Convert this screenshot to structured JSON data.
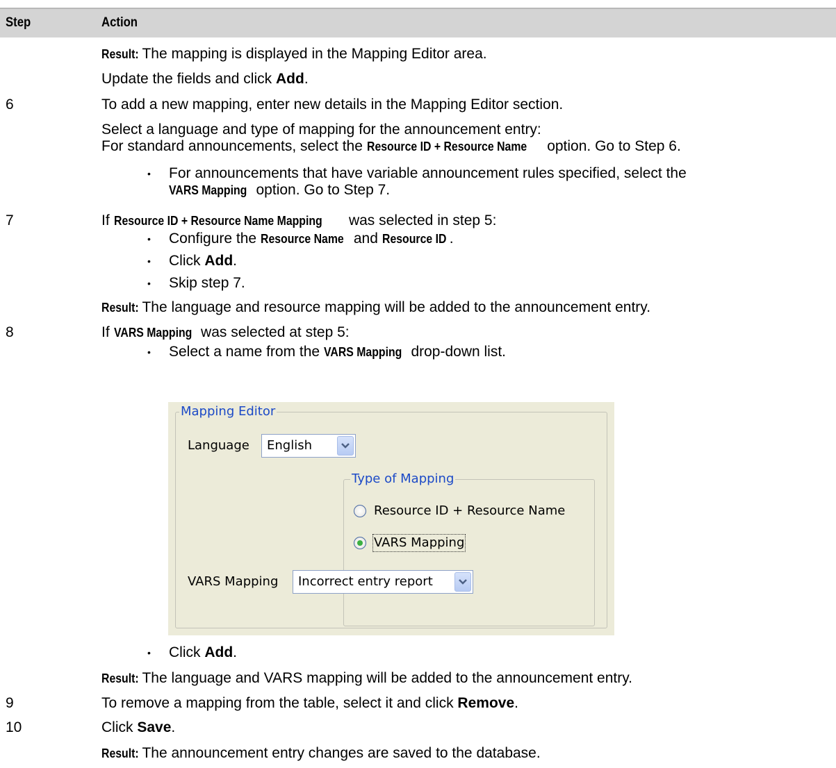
{
  "header": {
    "step": "Step",
    "action": "Action"
  },
  "rows": {
    "result1": {
      "label": "Result:",
      "text": " The mapping is displayed in the Mapping Editor area."
    },
    "update": {
      "pre": "Update the fields and click ",
      "bold": "Add",
      "post": "."
    },
    "s6": {
      "num": "6",
      "text": "To add a new mapping, enter new details in the Mapping Editor section."
    },
    "select_lang": "Select a language and type of mapping for the announcement entry:",
    "standard": {
      "pre": "For standard announcements, select the ",
      "bold": "Resource ID + Resource Name",
      "post": " option. Go to Step 6."
    },
    "vars_b1": "For announcements that have variable announcement rules specified, select the",
    "vars_b2": {
      "bold": "VARS Mapping",
      "post": " option. Go to Step 7."
    },
    "s7": {
      "num": "7",
      "pre": "If ",
      "bold": "Resource ID + Resource Name Mapping",
      "post": " was selected in step 5:"
    },
    "s7_b1": {
      "pre": "Configure the ",
      "bold1": "Resource Name",
      "mid": " and ",
      "bold2": "Resource ID",
      "post": "."
    },
    "s7_b2": {
      "pre": "Click ",
      "bold": "Add",
      "post": "."
    },
    "s7_b3": "Skip step 7.",
    "result2": {
      "label": "Result:",
      "text": " The language and resource mapping will be added to the announcement entry."
    },
    "s8": {
      "num": "8",
      "pre": "If ",
      "bold": "VARS Mapping",
      "post": " was selected at step 5:"
    },
    "s8_b1": {
      "pre": "Select a name from the ",
      "bold": "VARS Mapping",
      "post": " drop-down list."
    },
    "s8_b2": {
      "pre": "Click ",
      "bold": "Add",
      "post": "."
    },
    "result3": {
      "label": "Result:",
      "text": " The language and VARS mapping will be added to the announcement entry."
    },
    "s9": {
      "num": "9",
      "pre": "To remove a mapping from the table, select it and click ",
      "bold": "Remove",
      "post": "."
    },
    "s10": {
      "num": "10",
      "pre": "Click ",
      "bold": "Save",
      "post": "."
    },
    "result4": {
      "label": "Result:",
      "text": " The announcement entry changes are saved to the database."
    }
  },
  "editor": {
    "title": "Mapping Editor",
    "language_label": "Language",
    "language_value": "English",
    "type_title": "Type of Mapping",
    "radio1": "Resource ID + Resource Name",
    "radio2": "VARS Mapping",
    "vars_label": "VARS Mapping",
    "vars_value": "Incorrect entry report",
    "selected_option": "VARS Mapping",
    "chevron": "chevron-down-icon"
  },
  "bullet": "•"
}
